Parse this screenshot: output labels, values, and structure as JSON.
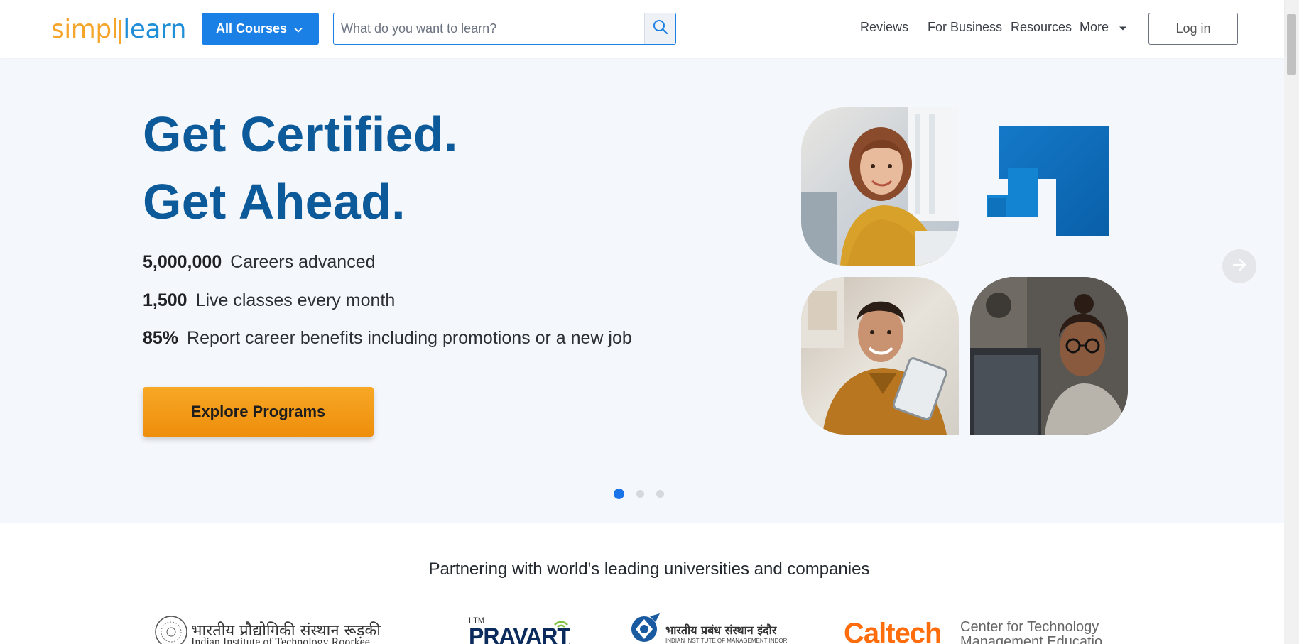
{
  "header": {
    "logo_part1": "simpl",
    "logo_part2": "learn",
    "all_courses_label": "All Courses",
    "search_placeholder": "What do you want to learn?",
    "nav": {
      "reviews": "Reviews",
      "for_business": "For Business",
      "resources": "Resources",
      "more": "More"
    },
    "login_label": "Log in"
  },
  "hero": {
    "title_line1": "Get Certified.",
    "title_line2": "Get Ahead.",
    "stats": [
      {
        "value": "5,000,000",
        "label": "Careers advanced"
      },
      {
        "value": "1,500",
        "label": "Live classes every month"
      },
      {
        "value": "85%",
        "label": "Report career benefits including promotions or a new job"
      }
    ],
    "cta_label": "Explore Programs",
    "carousel": {
      "slides": 3,
      "active": 1
    }
  },
  "partners": {
    "title": "Partnering with world's leading universities and companies",
    "logos": [
      {
        "line1": "भारतीय प्रौद्योगिकी संस्थान रूड़की",
        "line2": "Indian Institute of Technology Roorkee"
      },
      {
        "line1": "IITM",
        "line2": "PRAVARTAK"
      },
      {
        "line1": "भारतीय प्रबंध संस्थान इंदौर",
        "line2": "INDIAN INSTITUTE OF MANAGEMENT INDORE"
      },
      {
        "line1": "Caltech",
        "line2": "Center for Technology &",
        "line3": "Management Education"
      }
    ]
  },
  "colors": {
    "brand_blue": "#1a80e5",
    "headline_blue": "#0c5a9a",
    "cta_orange": "#f39c12",
    "logo_orange": "#f6a52b",
    "caltech_orange": "#ff6c0c"
  }
}
